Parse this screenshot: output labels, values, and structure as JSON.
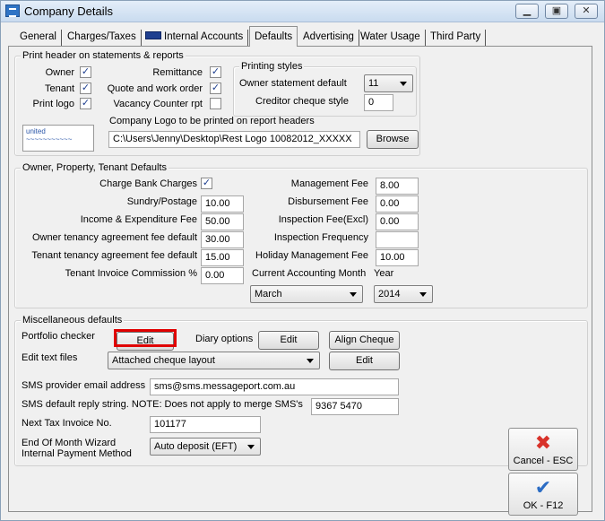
{
  "window": {
    "title": "Company Details",
    "controls": [
      "▁",
      "▣",
      "✕"
    ]
  },
  "tabs": [
    {
      "label": "General",
      "active": false
    },
    {
      "label": "Charges/Taxes",
      "active": false
    },
    {
      "label": "Internal Accounts",
      "active": false,
      "icon": "key-icon"
    },
    {
      "label": "Defaults",
      "active": true
    },
    {
      "label": "Advertising",
      "active": false
    },
    {
      "label": "Water Usage",
      "active": false
    },
    {
      "label": "Third Party",
      "active": false
    }
  ],
  "print_header": {
    "group_label": "Print header on statements & reports",
    "owner_label": "Owner",
    "owner_checked": true,
    "tenant_label": "Tenant",
    "tenant_checked": true,
    "print_logo_label": "Print logo",
    "print_logo_checked": true,
    "remittance_label": "Remittance",
    "remittance_checked": true,
    "quote_label": "Quote and work order",
    "quote_checked": true,
    "vacancy_label": "Vacancy Counter rpt",
    "vacancy_checked": false,
    "check_mark": "✓",
    "printing_styles": {
      "group_label": "Printing styles",
      "owner_statement_label": "Owner statement default",
      "owner_statement_value": "11",
      "creditor_cheque_label": "Creditor cheque style",
      "creditor_cheque_value": "0"
    },
    "logo_label": "Company Logo to be printed on report headers",
    "logo_path": "C:\\Users\\Jenny\\Desktop\\Rest Logo 10082012_XXXXX",
    "browse_label": "Browse",
    "logo_preview_text": "united"
  },
  "defaults": {
    "group_label": "Owner, Property, Tenant Defaults",
    "charge_bank_label": "Charge Bank Charges",
    "charge_bank_checked": true,
    "sundry_label": "Sundry/Postage",
    "sundry_value": "10.00",
    "income_label": "Income & Expenditure Fee",
    "income_value": "50.00",
    "owner_tenancy_label": "Owner tenancy agreement fee default",
    "owner_tenancy_value": "30.00",
    "tenant_tenancy_label": "Tenant tenancy agreement fee default",
    "tenant_tenancy_value": "15.00",
    "tenant_invoice_label": "Tenant Invoice Commission %",
    "tenant_invoice_value": "0.00",
    "management_fee_label": "Management Fee",
    "management_fee_value": "8.00",
    "disbursement_label": "Disbursement Fee",
    "disbursement_value": "0.00",
    "inspection_fee_label": "Inspection Fee(Excl)",
    "inspection_fee_value": "0.00",
    "inspection_freq_label": "Inspection Frequency",
    "inspection_freq_value": "",
    "holiday_label": "Holiday Management Fee",
    "holiday_value": "10.00",
    "accounting_month_label": "Current Accounting Month",
    "accounting_month_value": "March",
    "year_label": "Year",
    "year_value": "2014"
  },
  "misc": {
    "group_label": "Miscellaneous defaults",
    "portfolio_label": "Portfolio checker",
    "portfolio_edit": "Edit",
    "diary_label": "Diary options",
    "diary_edit": "Edit",
    "align_cheque": "Align Cheque",
    "edit_text_label": "Edit text files",
    "edit_text_value": "Attached cheque layout",
    "edit_text_edit": "Edit",
    "sms_email_label": "SMS provider email address",
    "sms_email_value": "sms@sms.messageport.com.au",
    "sms_reply_label": "SMS default reply string. NOTE: Does not apply to merge SMS's",
    "sms_reply_value": "9367 5470",
    "next_tax_label": "Next Tax Invoice No.",
    "next_tax_value": "101177",
    "eom_label_1": "End Of Month Wizard",
    "eom_label_2": "Internal Payment Method",
    "eom_value": "Auto deposit (EFT)"
  },
  "side_buttons": {
    "cancel_label": "Cancel - ESC",
    "cancel_icon": "✖",
    "ok_label": "OK - F12",
    "ok_icon": "✔"
  },
  "colors": {
    "highlight": "#e00000",
    "cancel_icon": "#d8322a",
    "ok_icon": "#2b6cc4"
  }
}
